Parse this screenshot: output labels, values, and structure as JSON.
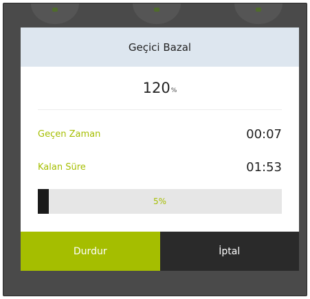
{
  "dialog": {
    "title": "Geçici Bazal",
    "rate_value": "120",
    "rate_unit": "%",
    "elapsed_label": "Geçen Zaman",
    "elapsed_value": "00:07",
    "remaining_label": "Kalan Süre",
    "remaining_value": "01:53",
    "progress_text": "5%",
    "progress_fraction": 0.05,
    "stop_label": "Durdur",
    "cancel_label": "İptal"
  },
  "colors": {
    "accent": "#a5be00",
    "header_bg": "#dde6ef",
    "dark_button": "#2a2a2a",
    "backdrop": "#4a4a4a"
  },
  "background": {
    "icons": [
      "pump-icon",
      "drop-icon",
      "settings-icon"
    ]
  }
}
